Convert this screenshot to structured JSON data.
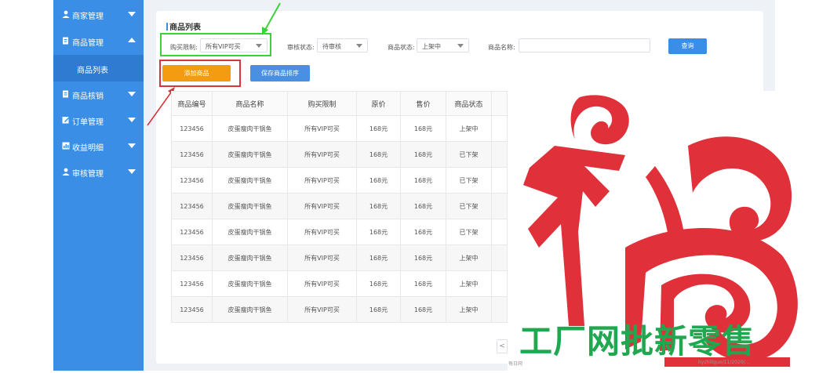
{
  "sidebar": {
    "items": [
      {
        "label": "商家管理",
        "icon": "user-icon",
        "expanded": false
      },
      {
        "label": "商品管理",
        "icon": "document-icon",
        "expanded": true
      },
      {
        "label": "商品核销",
        "icon": "document-icon",
        "expanded": false
      },
      {
        "label": "订单管理",
        "icon": "edit-icon",
        "expanded": false
      },
      {
        "label": "收益明细",
        "icon": "chart-icon",
        "expanded": false
      },
      {
        "label": "审核管理",
        "icon": "user-icon",
        "expanded": false
      }
    ],
    "submenu_active": "商品列表"
  },
  "panel": {
    "title": "商品列表"
  },
  "filters": {
    "purchase_limit_label": "购买限制:",
    "purchase_limit_value": "所有VIP可买",
    "audit_label": "审核状态:",
    "audit_value": "待审核",
    "status_label": "商品状态:",
    "status_value": "上架中",
    "name_label": "商品名称:",
    "name_value": "",
    "query_button": "查询"
  },
  "actions": {
    "add_button": "添加商品",
    "save_sort_button": "保存商品排序"
  },
  "table": {
    "columns": [
      "商品编号",
      "商品名称",
      "购买限制",
      "原价",
      "售价",
      "商品状态"
    ],
    "rows": [
      [
        "123456",
        "皮蛋瘦肉干锅鱼",
        "所有VIP可买",
        "168元",
        "168元",
        "上架中"
      ],
      [
        "123456",
        "皮蛋瘦肉干锅鱼",
        "所有VIP可买",
        "168元",
        "168元",
        "已下架"
      ],
      [
        "123456",
        "皮蛋瘦肉干锅鱼",
        "所有VIP可买",
        "168元",
        "168元",
        "已下架"
      ],
      [
        "123456",
        "皮蛋瘦肉干锅鱼",
        "所有VIP可买",
        "168元",
        "168元",
        "已下架"
      ],
      [
        "123456",
        "皮蛋瘦肉干锅鱼",
        "所有VIP可买",
        "168元",
        "168元",
        "已下架"
      ],
      [
        "123456",
        "皮蛋瘦肉干锅鱼",
        "所有VIP可买",
        "168元",
        "168元",
        "上架中"
      ],
      [
        "123456",
        "皮蛋瘦肉干锅鱼",
        "所有VIP可买",
        "168元",
        "168元",
        "上架中"
      ],
      [
        "123456",
        "皮蛋瘦肉干锅鱼",
        "所有VIP可买",
        "168元",
        "168元",
        "上架中"
      ]
    ]
  },
  "pager": {
    "prev": "<"
  },
  "overlay": {
    "slogan": "工厂网批新零售",
    "logo": "福",
    "watermark_left": "每日网",
    "watermark_right": "hyzhiliguo/11/2020/...",
    "slogan_color": "#1fa84f",
    "logo_color": "#e0303a"
  },
  "colors": {
    "sidebar": "#3a8ee6",
    "add_button": "#f39c12",
    "query_button": "#3a8ee6",
    "green_highlight": "#3cd23c",
    "red_highlight": "#d9333f"
  }
}
